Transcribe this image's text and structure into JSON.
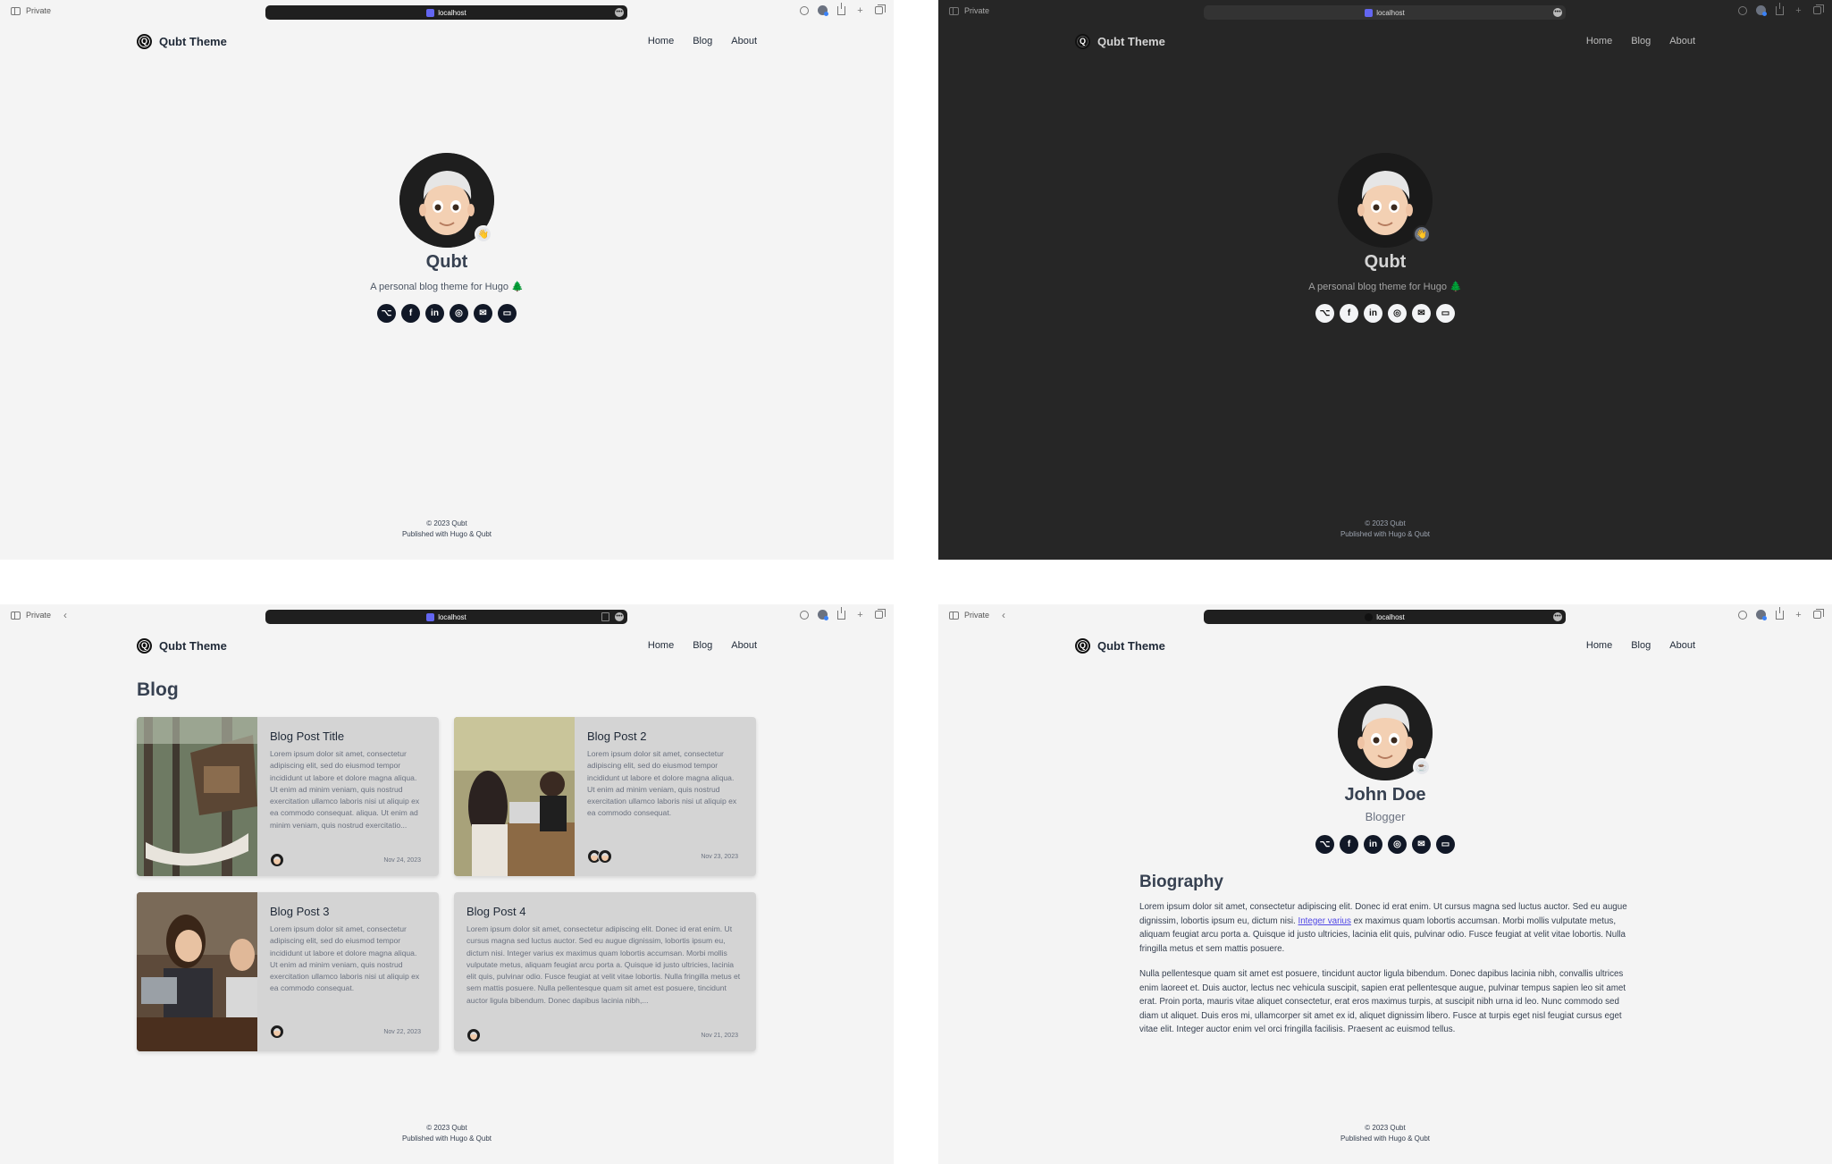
{
  "browser": {
    "private_label": "Private",
    "url": "localhost"
  },
  "site": {
    "brand_initial": "Q",
    "brand_name": "Qubt Theme",
    "nav": [
      "Home",
      "Blog",
      "About"
    ],
    "footer_copyright": "© 2023 Qubt",
    "footer_published": "Published with Hugo & Qubt"
  },
  "home": {
    "name": "Qubt",
    "tagline": "A personal blog theme for Hugo 🌲",
    "status_emoji": "👋",
    "socials": [
      "github-icon",
      "facebook-icon",
      "linkedin-icon",
      "instagram-icon",
      "email-icon",
      "laptop-icon"
    ]
  },
  "blog": {
    "heading": "Blog",
    "posts": [
      {
        "title": "Blog Post Title",
        "excerpt": "Lorem ipsum dolor sit amet, consectetur adipiscing elit, sed do eiusmod tempor incididunt ut labore et dolore magna aliqua. Ut enim ad minim veniam, quis nostrud exercitation ullamco laboris nisi ut aliquip ex ea commodo consequat. aliqua. Ut enim ad minim veniam, quis nostrud exercitatio...",
        "date": "Nov 24, 2023",
        "authors": 1
      },
      {
        "title": "Blog Post 2",
        "excerpt": "Lorem ipsum dolor sit amet, consectetur adipiscing elit, sed do eiusmod tempor incididunt ut labore et dolore magna aliqua. Ut enim ad minim veniam, quis nostrud exercitation ullamco laboris nisi ut aliquip ex ea commodo consequat.",
        "date": "Nov 23, 2023",
        "authors": 2
      },
      {
        "title": "Blog Post 3",
        "excerpt": "Lorem ipsum dolor sit amet, consectetur adipiscing elit, sed do eiusmod tempor incididunt ut labore et dolore magna aliqua. Ut enim ad minim veniam, quis nostrud exercitation ullamco laboris nisi ut aliquip ex ea commodo consequat.",
        "date": "Nov 22, 2023",
        "authors": 1
      },
      {
        "title": "Blog Post 4",
        "excerpt": "Lorem ipsum dolor sit amet, consectetur adipiscing elit. Donec id erat enim. Ut cursus magna sed luctus auctor. Sed eu augue dignissim, lobortis ipsum eu, dictum nisi. Integer varius ex maximus quam lobortis accumsan. Morbi mollis vulputate metus, aliquam feugiat arcu porta a. Quisque id justo ultricies, lacinia elit quis, pulvinar odio. Fusce feugiat at velit vitae lobortis. Nulla fringilla metus et sem mattis posuere. Nulla pellentesque quam sit amet est posuere, tincidunt auctor ligula bibendum. Donec dapibus lacinia nibh,...",
        "date": "Nov 21, 2023",
        "authors": 1
      }
    ]
  },
  "about": {
    "name": "John Doe",
    "role": "Blogger",
    "status_emoji": "☕",
    "bio_heading": "Biography",
    "bio_p1_before": "Lorem ipsum dolor sit amet, consectetur adipiscing elit. Donec id erat enim. Ut cursus magna sed luctus auctor. Sed eu augue dignissim, lobortis ipsum eu, dictum nisi. ",
    "bio_p1_link": "Integer varius",
    "bio_p1_after": " ex maximus quam lobortis accumsan. Morbi mollis vulputate metus, aliquam feugiat arcu porta a. Quisque id justo ultricies, lacinia elit quis, pulvinar odio. Fusce feugiat at velit vitae lobortis. Nulla fringilla metus et sem mattis posuere.",
    "bio_p2": "Nulla pellentesque quam sit amet est posuere, tincidunt auctor ligula bibendum. Donec dapibus lacinia nibh, convallis ultrices enim laoreet et. Duis auctor, lectus nec vehicula suscipit, sapien erat pellentesque augue, pulvinar tempus sapien leo sit amet erat. Proin porta, mauris vitae aliquet consectetur, erat eros maximus turpis, at suscipit nibh urna id leo. Nunc commodo sed diam ut aliquet. Duis eros mi, ullamcorper sit amet ex id, aliquet dignissim libero. Fusce at turpis eget nisl feugiat cursus eget vitae elit. Integer auctor enim vel orci fringilla facilisis. Praesent ac euismod tellus."
  },
  "colors": {
    "light_bg": "#f4f4f4",
    "dark_bg": "#262626",
    "card_bg": "#d4d4d4",
    "link": "#4f46e5"
  }
}
